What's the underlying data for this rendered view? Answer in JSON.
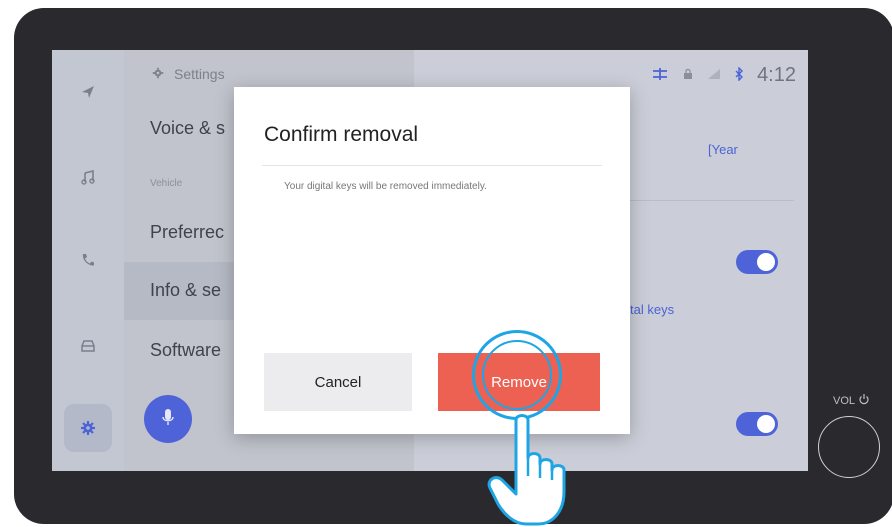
{
  "status_bar": {
    "time": "4:12"
  },
  "settings_list": {
    "header": "Settings",
    "items": [
      {
        "label": "Voice & s"
      },
      {
        "label": "Preferrec"
      },
      {
        "label": "Info & se"
      },
      {
        "label": "Software"
      }
    ],
    "section_label": "Vehicle"
  },
  "right_pane": {
    "year_link": "[Year",
    "keys_link": "tal keys"
  },
  "dialog": {
    "title": "Confirm removal",
    "message": "Your digital keys will be removed immediately.",
    "cancel_label": "Cancel",
    "remove_label": "Remove"
  },
  "volume": {
    "label": "VOL"
  },
  "colors": {
    "accent": "#4f63d9",
    "danger": "#ec6152",
    "tap_indicator": "#1ea5e6"
  },
  "icons": [
    "navigation-icon",
    "music-icon",
    "phone-icon",
    "car-icon",
    "gear-icon",
    "microphone-icon",
    "power-icon"
  ]
}
